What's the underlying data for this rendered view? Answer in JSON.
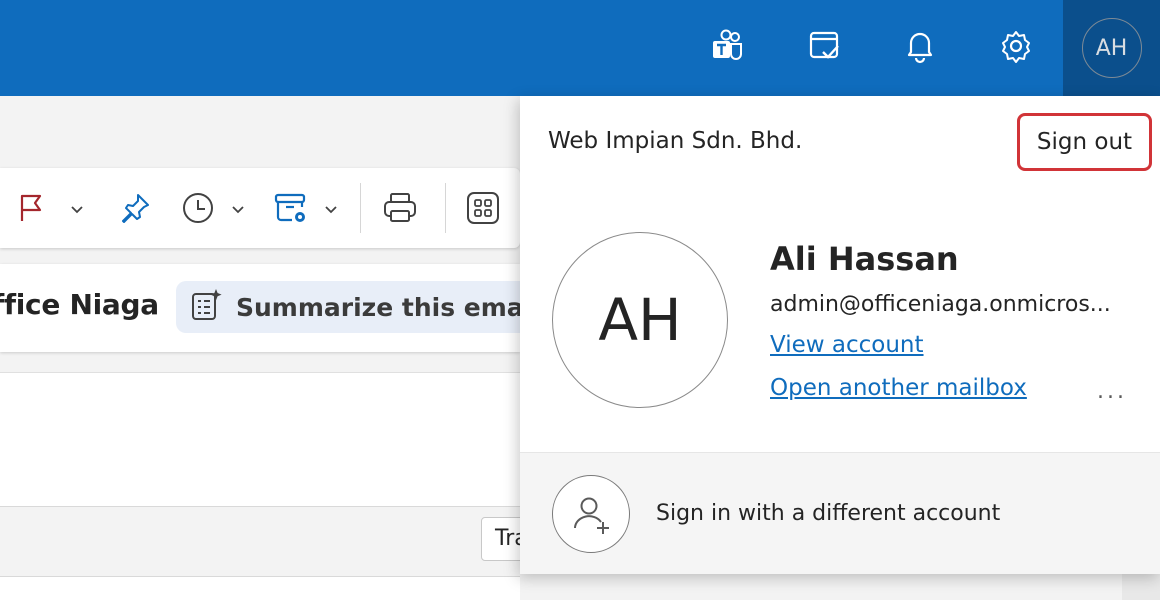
{
  "topbar": {
    "icons": [
      "teams-icon",
      "todo-icon",
      "bell-icon",
      "gear-icon"
    ],
    "avatar_initials": "AH",
    "brand_color": "#0f6cbd"
  },
  "toolbar": {
    "icons": [
      "flag-icon",
      "pin-icon",
      "clock-icon",
      "archive-rules-icon",
      "print-icon",
      "apps-icon"
    ]
  },
  "message": {
    "sender": "ffice Niaga",
    "summarize_label": "Summarize this email",
    "translate_label": "Tra"
  },
  "account": {
    "org_name": "Web Impian Sdn. Bhd.",
    "sign_out_label": "Sign out",
    "initials": "AH",
    "name": "Ali Hassan",
    "email": "admin@officeniaga.onmicros...",
    "view_account_label": "View account",
    "open_mailbox_label": "Open another mailbox",
    "more_label": "...",
    "different_account_label": "Sign in with a different account",
    "highlight_color": "#d13438",
    "link_color": "#0f6cbd"
  }
}
